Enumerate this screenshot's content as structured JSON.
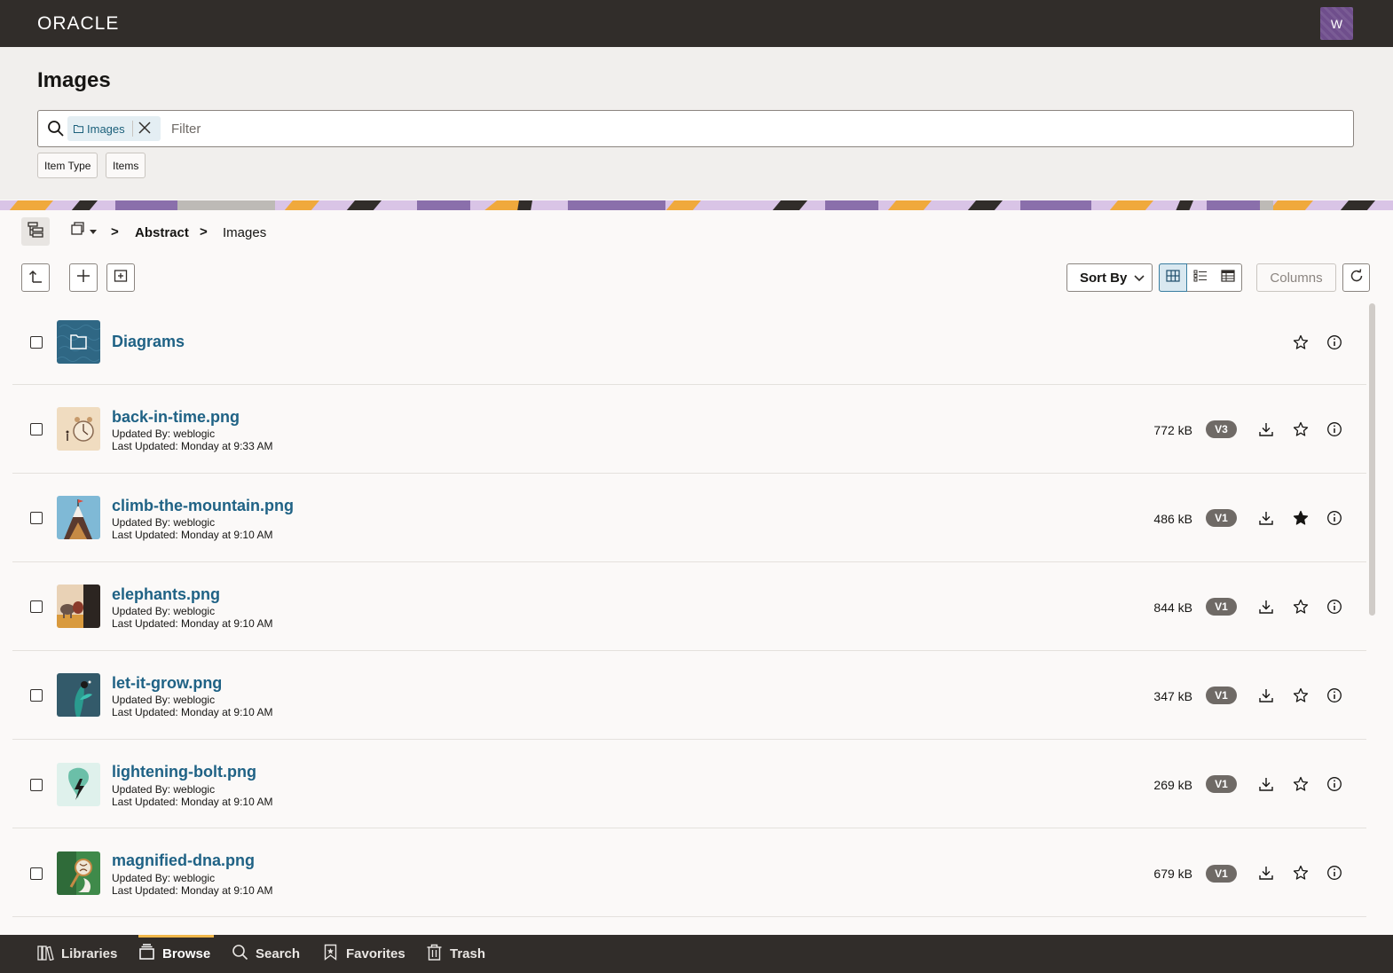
{
  "app": {
    "logo": "ORACLE",
    "user_initial": "W"
  },
  "header": {
    "title": "Images",
    "search": {
      "chip_label": "Images",
      "placeholder": "Filter"
    },
    "facets": [
      "Item Type",
      "Items"
    ]
  },
  "breadcrumb": {
    "parent": "Abstract",
    "current": "Images",
    "separator": ">"
  },
  "toolbar": {
    "sort_label": "Sort By",
    "columns_label": "Columns"
  },
  "items": [
    {
      "type": "folder",
      "name": "Diagrams",
      "favorite": false
    },
    {
      "type": "file",
      "name": "back-in-time.png",
      "updated_by": "Updated By: weblogic",
      "last_updated": "Last Updated: Monday at 9:33 AM",
      "size": "772 kB",
      "version": "V3",
      "favorite": false
    },
    {
      "type": "file",
      "name": "climb-the-mountain.png",
      "updated_by": "Updated By: weblogic",
      "last_updated": "Last Updated: Monday at 9:10 AM",
      "size": "486 kB",
      "version": "V1",
      "favorite": true
    },
    {
      "type": "file",
      "name": "elephants.png",
      "updated_by": "Updated By: weblogic",
      "last_updated": "Last Updated: Monday at 9:10 AM",
      "size": "844 kB",
      "version": "V1",
      "favorite": false
    },
    {
      "type": "file",
      "name": "let-it-grow.png",
      "updated_by": "Updated By: weblogic",
      "last_updated": "Last Updated: Monday at 9:10 AM",
      "size": "347 kB",
      "version": "V1",
      "favorite": false
    },
    {
      "type": "file",
      "name": "lightening-bolt.png",
      "updated_by": "Updated By: weblogic",
      "last_updated": "Last Updated: Monday at 9:10 AM",
      "size": "269 kB",
      "version": "V1",
      "favorite": false
    },
    {
      "type": "file",
      "name": "magnified-dna.png",
      "updated_by": "Updated By: weblogic",
      "last_updated": "Last Updated: Monday at 9:10 AM",
      "size": "679 kB",
      "version": "V1",
      "favorite": false
    }
  ],
  "bottom_nav": [
    {
      "label": "Libraries",
      "icon": "libraries-icon",
      "active": false
    },
    {
      "label": "Browse",
      "icon": "browse-icon",
      "active": true
    },
    {
      "label": "Search",
      "icon": "search-icon",
      "active": false
    },
    {
      "label": "Favorites",
      "icon": "bookmark-icon",
      "active": false
    },
    {
      "label": "Trash",
      "icon": "trash-icon",
      "active": false
    }
  ],
  "colors": {
    "brand_bar": "#312d2a",
    "link": "#1f6285",
    "active_tab": "#f0b74a",
    "avatar": "#6f4e8c"
  }
}
